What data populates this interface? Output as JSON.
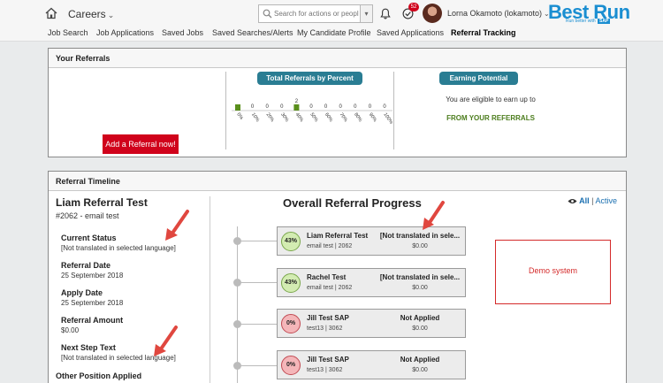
{
  "header": {
    "app_title": "Careers",
    "search_placeholder": "Search for actions or people",
    "notification_count": "52",
    "user_name": "Lorna Okamoto (lokamoto)",
    "brand": "Best Run",
    "brand_tagline": "Run better with",
    "brand_sap": "SAP"
  },
  "nav": {
    "items": [
      {
        "label": "Job Search"
      },
      {
        "label": "Job Applications"
      },
      {
        "label": "Saved Jobs"
      },
      {
        "label": "Saved Searches/Alerts"
      },
      {
        "label": "My Candidate Profile"
      },
      {
        "label": "Saved Applications"
      },
      {
        "label": "Referral Tracking",
        "active": true
      }
    ]
  },
  "referrals": {
    "title": "Your Referrals",
    "add_button": "Add a Referral now!",
    "total_label": "Total Referrals by Percent",
    "earning_label": "Earning Potential",
    "eligible_text": "You are eligible to earn up to",
    "from_text": "FROM YOUR REFERRALS",
    "chart_data": {
      "type": "bar",
      "categories": [
        "0%",
        "10%",
        "20%",
        "30%",
        "40%",
        "50%",
        "60%",
        "70%",
        "80%",
        "90%",
        "100%"
      ],
      "values": [
        2,
        0,
        0,
        0,
        2,
        0,
        0,
        0,
        0,
        0,
        0
      ],
      "value_labels": [
        "",
        "0",
        "0",
        "0",
        "2",
        "0",
        "0",
        "0",
        "0",
        "0",
        "0"
      ],
      "bar_color": "#5a8f1c"
    }
  },
  "timeline": {
    "title": "Referral Timeline",
    "candidate": {
      "name": "Liam Referral Test",
      "sub": "#2062 - email test",
      "fields": [
        {
          "label": "Current Status",
          "value": "[Not translated in selected language]"
        },
        {
          "label": "Referral Date",
          "value": "25 September 2018"
        },
        {
          "label": "Apply Date",
          "value": "25 September 2018"
        },
        {
          "label": "Referral Amount",
          "value": "$0.00"
        },
        {
          "label": "Next Step Text",
          "value": "[Not translated in selected language]"
        }
      ],
      "other_label": "Other Position Applied"
    },
    "progress_title": "Overall Referral Progress",
    "filter_all": "All",
    "filter_sep": "|",
    "filter_active": "Active",
    "cards": [
      {
        "percent": "43%",
        "name": "Liam Referral Test",
        "sub": "email test | 2062",
        "status": "[Not translated in sele...",
        "amount": "$0.00",
        "tone": "green"
      },
      {
        "percent": "43%",
        "name": "Rachel Test",
        "sub": "email test | 2062",
        "status": "[Not translated in sele...",
        "amount": "$0.00",
        "tone": "green"
      },
      {
        "percent": "0%",
        "name": "Jill Test SAP",
        "sub": "test13 | 3062",
        "status": "Not Applied",
        "amount": "$0.00",
        "tone": "red"
      },
      {
        "percent": "0%",
        "name": "Jill Test SAP",
        "sub": "test13 | 3062",
        "status": "Not Applied",
        "amount": "$0.00",
        "tone": "red"
      }
    ],
    "demo_label": "Demo system"
  },
  "colors": {
    "accent_red": "#d0021b",
    "pill_teal": "#2a7d93",
    "brand_blue": "#1a8ed1",
    "arrow_red": "#e0473f"
  }
}
